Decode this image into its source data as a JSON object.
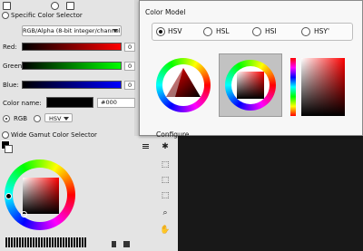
{
  "specific_selector": {
    "title": "Specific Color Selector",
    "mode_combo": "RGB/Alpha (8-bit integer/channel)",
    "red_label": "Red:",
    "green_label": "Green:",
    "blue_label": "Blue:",
    "red_value": "0",
    "green_value": "0",
    "blue_value": "0",
    "color_name_label": "Color name:",
    "color_name_value": "#000",
    "rgb_label": "RGB",
    "hsv_combo": "HSV"
  },
  "wide_gamut": {
    "title": "Wide Gamut Color Selector"
  },
  "popup": {
    "title": "Color Model",
    "models": [
      {
        "label": "HSV",
        "selected": true
      },
      {
        "label": "HSL",
        "selected": false
      },
      {
        "label": "HSI",
        "selected": false
      },
      {
        "label": "HSY'",
        "selected": false
      }
    ],
    "configure_label": "Configure..."
  },
  "colors": {
    "canvas": "#181818",
    "panel": "#e4e4e4"
  }
}
